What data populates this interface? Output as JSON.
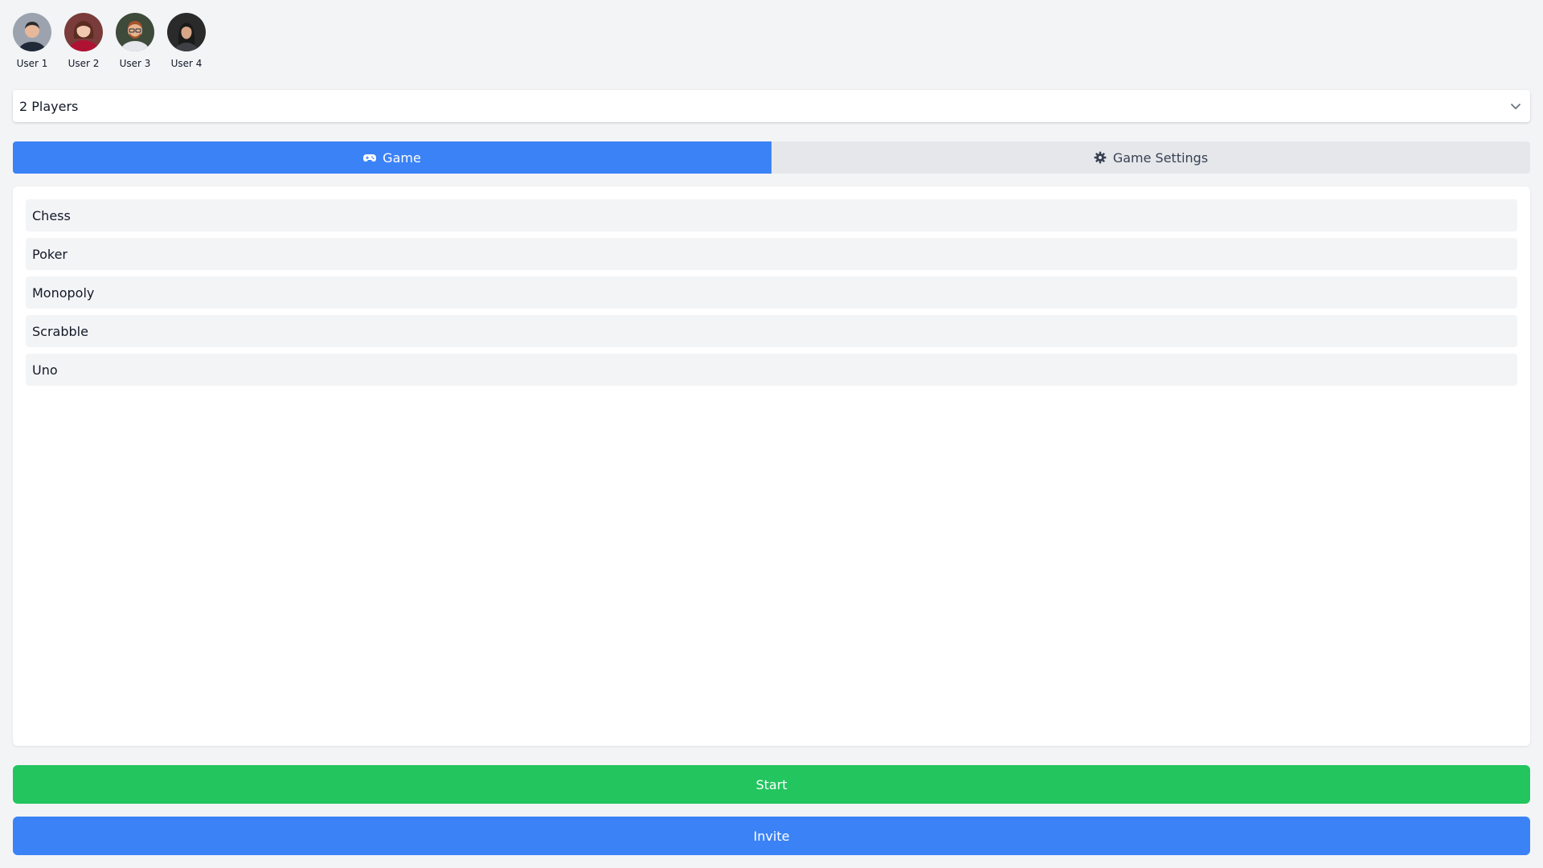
{
  "users": [
    {
      "name": "User 1",
      "avatar_bg": "#9ca3af",
      "skin": "#e8b89a",
      "hair": "#2b2b2b",
      "shirt": "#1f2937"
    },
    {
      "name": "User 2",
      "avatar_bg": "#7a3b3b",
      "skin": "#f0c9b0",
      "hair": "#5a2d1e",
      "shirt": "#b01233"
    },
    {
      "name": "User 3",
      "avatar_bg": "#3e4a3a",
      "skin": "#e6b48f",
      "hair": "#a5522a",
      "shirt": "#e5e7eb"
    },
    {
      "name": "User 4",
      "avatar_bg": "#2a2a2a",
      "skin": "#d7a687",
      "hair": "#1a1a1a",
      "shirt": "#3f3f46"
    }
  ],
  "player_select": {
    "value": "2 Players",
    "icon": "chevron-down-icon"
  },
  "tabs": [
    {
      "label": "Game",
      "icon": "gamepad-icon",
      "active": true
    },
    {
      "label": "Game Settings",
      "icon": "gear-icon",
      "active": false
    }
  ],
  "games": [
    "Chess",
    "Poker",
    "Monopoly",
    "Scrabble",
    "Uno"
  ],
  "buttons": {
    "start": "Start",
    "invite": "Invite"
  },
  "colors": {
    "primary": "#3b82f6",
    "success": "#22c55e",
    "background": "#f3f4f6",
    "tab_inactive": "#e5e7eb"
  }
}
